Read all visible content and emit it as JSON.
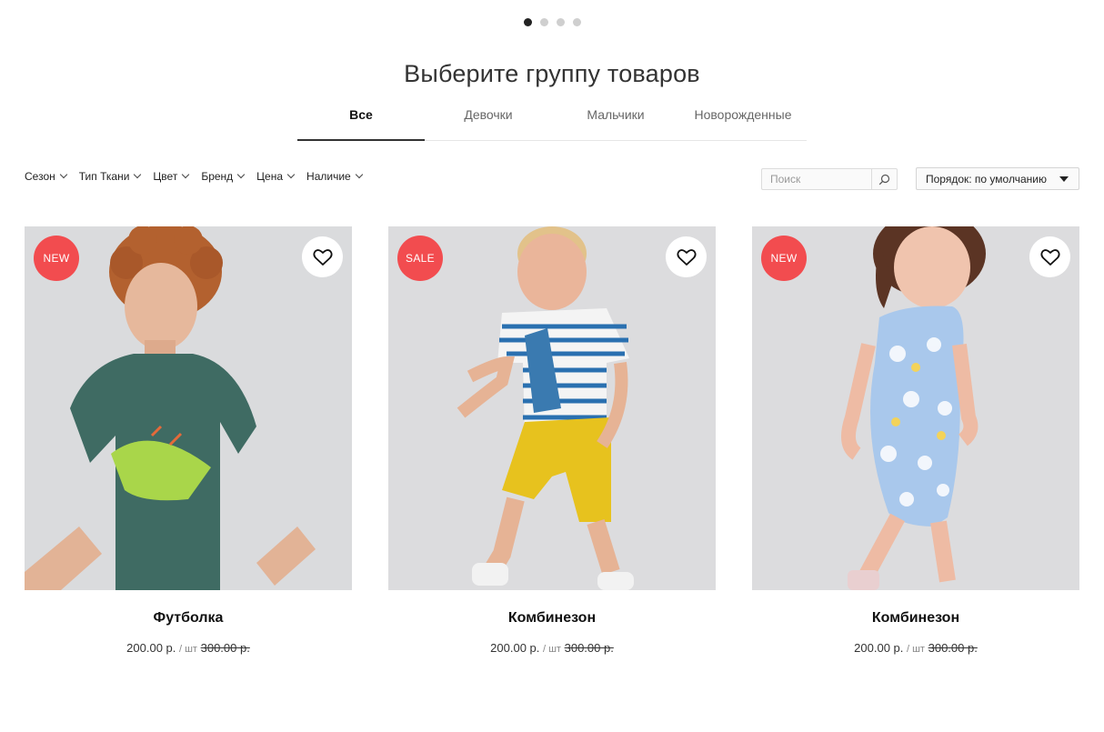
{
  "slider": {
    "dots": 4,
    "active": 0
  },
  "heading": "Выберите группу товаров",
  "tabs": [
    {
      "label": "Все",
      "active": true
    },
    {
      "label": "Девочки",
      "active": false
    },
    {
      "label": "Мальчики",
      "active": false
    },
    {
      "label": "Новорожденные",
      "active": false
    }
  ],
  "filters": [
    {
      "label": "Сезон"
    },
    {
      "label": "Тип Ткани"
    },
    {
      "label": "Цвет"
    },
    {
      "label": "Бренд"
    },
    {
      "label": "Цена"
    },
    {
      "label": "Наличие"
    }
  ],
  "search": {
    "placeholder": "Поиск",
    "value": "",
    "icon": "search-icon"
  },
  "sort": {
    "label": "Порядок: по умолчанию"
  },
  "products": [
    {
      "badge": "NEW",
      "title": "Футболка",
      "price": "200.00 р.",
      "unit": "/ шт",
      "old_price": "300.00 р."
    },
    {
      "badge": "SALE",
      "title": "Комбинезон",
      "price": "200.00 р.",
      "unit": "/ шт",
      "old_price": "300.00 р."
    },
    {
      "badge": "NEW",
      "title": "Комбинезон",
      "price": "200.00 р.",
      "unit": "/ шт",
      "old_price": "300.00 р."
    }
  ],
  "colors": {
    "badge": "#f24c4f",
    "accent": "#222222",
    "photo_bg": "#d9dadc"
  }
}
